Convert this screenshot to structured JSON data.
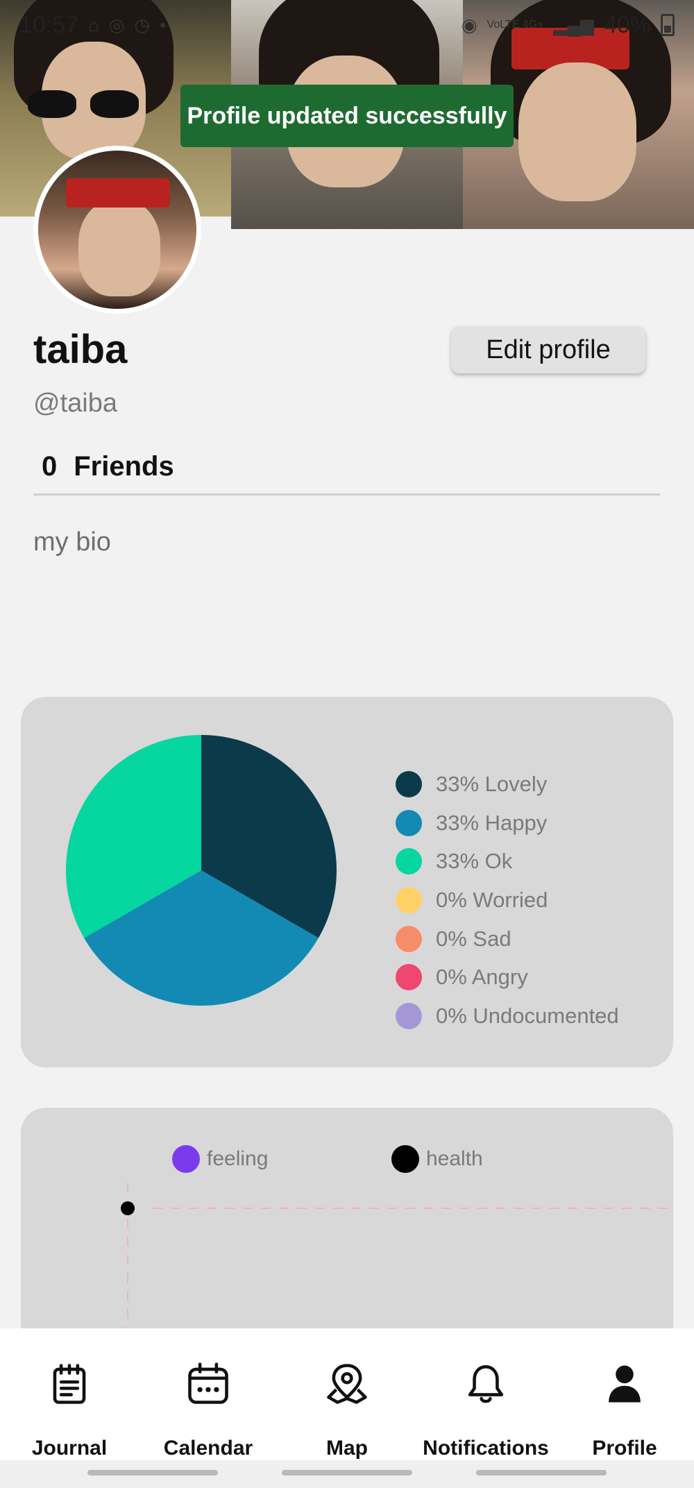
{
  "status_bar": {
    "time": "10:57",
    "network": "VoLTE 4G+",
    "battery": "40%"
  },
  "toast": {
    "message": "Profile updated successfully"
  },
  "profile": {
    "name": "taiba",
    "handle": "@taiba",
    "edit_button": "Edit profile",
    "friends_count": "0",
    "friends_label": "Friends",
    "bio": "my bio"
  },
  "mood_legend": [
    {
      "label": "33% Lovely",
      "color": "#0b3a4b"
    },
    {
      "label": "33% Happy",
      "color": "#128ab3"
    },
    {
      "label": "33% Ok",
      "color": "#06d6a0"
    },
    {
      "label": "0% Worried",
      "color": "#ffd166"
    },
    {
      "label": "0% Sad",
      "color": "#f78c6b"
    },
    {
      "label": "0% Angry",
      "color": "#ef476f"
    },
    {
      "label": "0% Undocumented",
      "color": "#a597d6"
    }
  ],
  "chart_data": [
    {
      "type": "pie",
      "categories": [
        "Lovely",
        "Happy",
        "Ok",
        "Worried",
        "Sad",
        "Angry",
        "Undocumented"
      ],
      "values": [
        33,
        33,
        33,
        0,
        0,
        0,
        0
      ],
      "colors": [
        "#0b3a4b",
        "#128ab3",
        "#06d6a0",
        "#ffd166",
        "#f78c6b",
        "#ef476f",
        "#a597d6"
      ],
      "legend": "right"
    },
    {
      "type": "line",
      "series": [
        {
          "name": "feeling",
          "color": "#7c3aed",
          "values": []
        },
        {
          "name": "health",
          "color": "#000000",
          "values": []
        }
      ],
      "grid": true
    }
  ],
  "line_legend": {
    "feeling": "feeling",
    "health": "health"
  },
  "nav": [
    {
      "label": "Journal",
      "icon": "journal-icon"
    },
    {
      "label": "Calendar",
      "icon": "calendar-icon"
    },
    {
      "label": "Map",
      "icon": "map-pin-icon"
    },
    {
      "label": "Notifications",
      "icon": "bell-icon"
    },
    {
      "label": "Profile",
      "icon": "person-icon"
    }
  ]
}
